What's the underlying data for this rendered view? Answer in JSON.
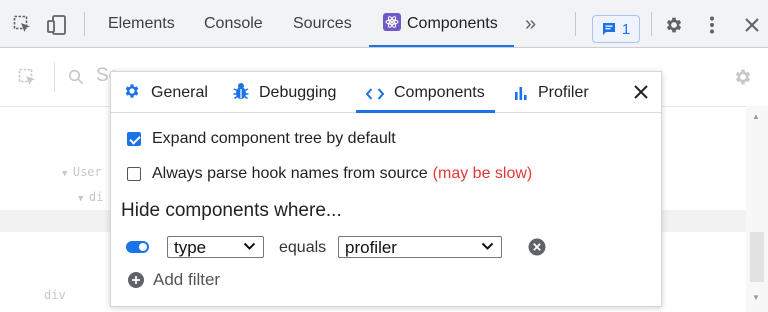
{
  "devtools": {
    "tabs": [
      {
        "label": "Elements"
      },
      {
        "label": "Console"
      },
      {
        "label": "Sources"
      },
      {
        "label": "Components"
      }
    ],
    "more_tabs_label": "»",
    "issues_count": "1"
  },
  "background": {
    "search_placeholder": "Se",
    "tree_rows": [
      "User",
      "di",
      "div"
    ]
  },
  "settings": {
    "tabs": [
      {
        "label": "General",
        "icon": "gear-icon"
      },
      {
        "label": "Debugging",
        "icon": "bug-icon"
      },
      {
        "label": "Components",
        "icon": "code-icon"
      },
      {
        "label": "Profiler",
        "icon": "bar-chart-icon"
      }
    ],
    "active_tab": "Components",
    "expand_tree": {
      "label": "Expand component tree by default",
      "checked": true
    },
    "parse_hooks": {
      "label": "Always parse hook names from source",
      "warning": "(may be slow)",
      "checked": false
    },
    "hide_title": "Hide components where...",
    "filter": {
      "enabled": true,
      "field": "type",
      "operator": "equals",
      "value": "profiler"
    },
    "add_filter_label": "Add filter"
  },
  "colors": {
    "accent": "#1a73e8",
    "warning": "#e53935",
    "react_icon_bg": "#6e5ac9"
  }
}
